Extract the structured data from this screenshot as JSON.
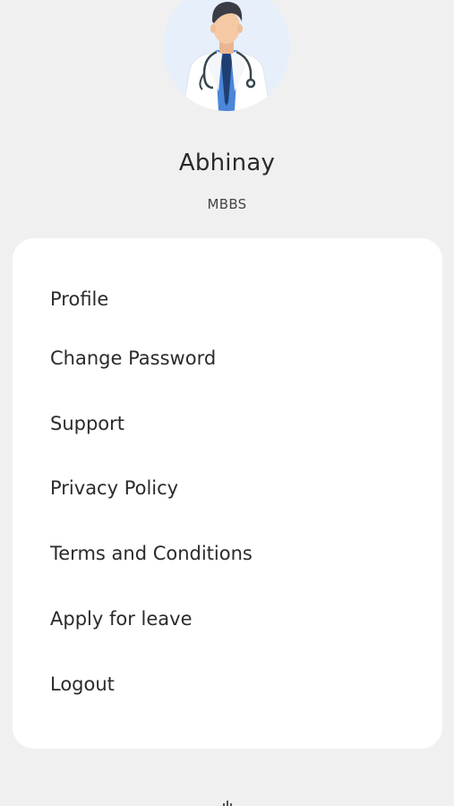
{
  "profile": {
    "name": "Abhinay",
    "degree": "MBBS",
    "avatar_icon": "doctor-avatar-icon"
  },
  "menu": {
    "items": [
      {
        "label": "Profile"
      },
      {
        "label": "Change Password"
      },
      {
        "label": "Support"
      },
      {
        "label": "Privacy Policy"
      },
      {
        "label": "Terms and Conditions"
      },
      {
        "label": "Apply for leave"
      },
      {
        "label": "Logout"
      }
    ]
  },
  "colors": {
    "background": "#f0f0f0",
    "card": "#ffffff",
    "avatar_bg": "#e7effb",
    "coat": "#ffffff",
    "shirt": "#4a86d9",
    "tie": "#1f3f72",
    "skin": "#f5c9a4",
    "hair": "#3c3c44",
    "stethoscope": "#37474f"
  }
}
